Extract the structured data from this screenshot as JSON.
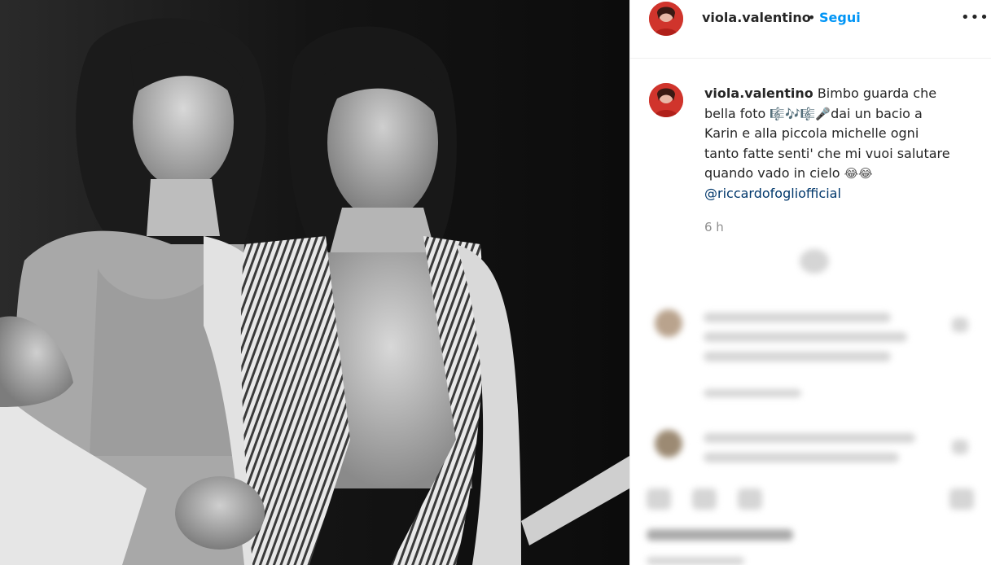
{
  "post": {
    "username": "viola.valentino",
    "separator": "•",
    "follow_label": "Segui",
    "more_icon": "more-horizontal-icon"
  },
  "caption": {
    "username": "viola.valentino",
    "line1": " Bimbo guarda che",
    "line2a": "bella foto ",
    "emojis": "🎼🎶🎼🎤",
    "line2b": "dai un bacio a",
    "line3": "Karin e alla piccola michelle ogni",
    "line4": "tanto fatte senti' che mi vuoi salutare",
    "line5": "quando vado in cielo ",
    "emojis2": "😂😂",
    "mention": "@riccardofogliofficial",
    "time": "6 h"
  },
  "colors": {
    "link": "#0095f6",
    "mention": "#00376b",
    "text": "#262626",
    "muted": "#8e8e8e"
  }
}
